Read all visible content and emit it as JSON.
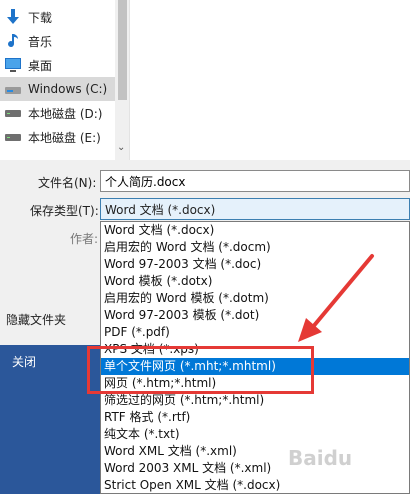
{
  "nav": {
    "items": [
      {
        "label": "下载",
        "icon": "download-arrow-icon"
      },
      {
        "label": "音乐",
        "icon": "music-note-icon"
      },
      {
        "label": "桌面",
        "icon": "desktop-icon"
      },
      {
        "label": "Windows (C:)",
        "icon": "windows-drive-icon"
      },
      {
        "label": "本地磁盘 (D:)",
        "icon": "hard-drive-icon"
      },
      {
        "label": "本地磁盘 (E:)",
        "icon": "hard-drive-icon"
      }
    ]
  },
  "form": {
    "filename_label": "文件名(N):",
    "filename_value": "个人简历.docx",
    "filetype_label": "保存类型(T):",
    "filetype_value": "Word 文档 (*.docx)",
    "author_label": "作者:",
    "hide_folders_label": "隐藏文件夹"
  },
  "close_label": "关闭",
  "type_options": [
    "Word 文档 (*.docx)",
    "启用宏的 Word 文档 (*.docm)",
    "Word 97-2003 文档 (*.doc)",
    "Word 模板 (*.dotx)",
    "启用宏的 Word 模板 (*.dotm)",
    "Word 97-2003 模板 (*.dot)",
    "PDF (*.pdf)",
    "XPS 文档 (*.xps)",
    "单个文件网页 (*.mht;*.mhtml)",
    "网页 (*.htm;*.html)",
    "筛选过的网页 (*.htm;*.html)",
    "RTF 格式 (*.rtf)",
    "纯文本 (*.txt)",
    "Word XML 文档 (*.xml)",
    "Word 2003 XML 文档 (*.xml)",
    "Strict Open XML 文档 (*.docx)"
  ],
  "selected_option": 8,
  "colors": {
    "accent": "#0078d7",
    "close_panel": "#2b579a",
    "annotation": "#e53935"
  },
  "watermark": "Baidu"
}
